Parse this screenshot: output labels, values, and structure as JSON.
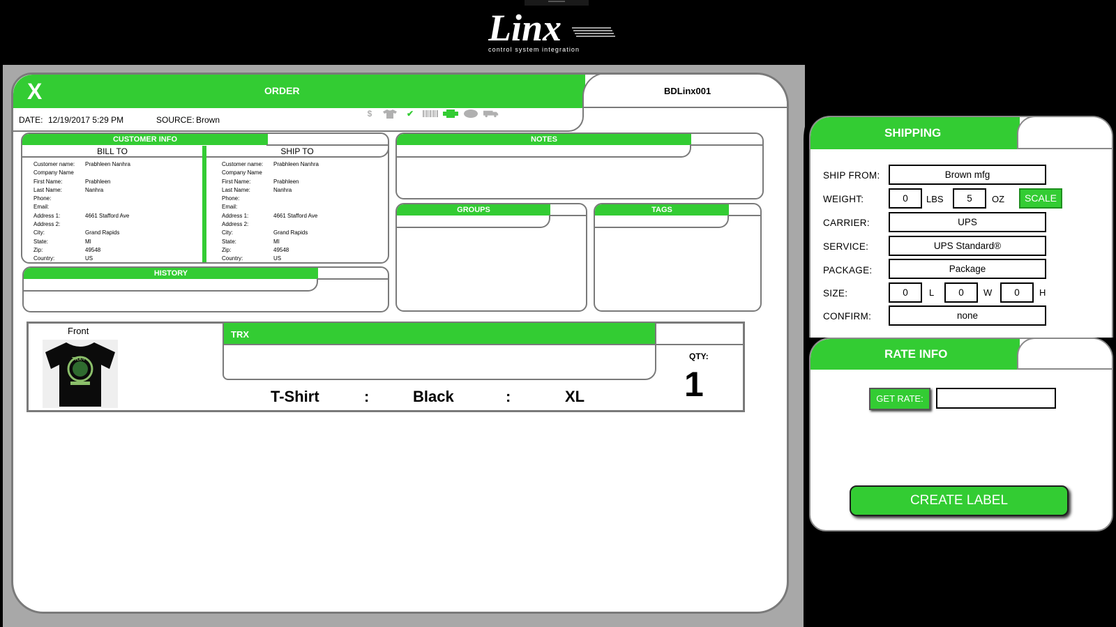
{
  "logo": {
    "text": "Linx",
    "tagline": "control system integration"
  },
  "order": {
    "close_label": "X",
    "title": "ORDER",
    "id": "BDLinx001",
    "date_label": "DATE:",
    "date_value": "12/19/2017 5:29 PM",
    "source_label": "SOURCE:",
    "source_value": "Brown",
    "status_icons": [
      {
        "icon": "dollar-icon",
        "glyph": "$",
        "color": "#b0b0b0"
      },
      {
        "icon": "tshirt-icon",
        "glyph": "",
        "color": "#b0b0b0"
      },
      {
        "icon": "check-icon",
        "glyph": "✔",
        "color": "#33cc33"
      },
      {
        "icon": "barcode-icon",
        "glyph": "",
        "color": "#b0b0b0"
      },
      {
        "icon": "printer-icon",
        "glyph": "",
        "color": "#33cc33"
      },
      {
        "icon": "package-icon",
        "glyph": "",
        "color": "#b0b0b0"
      },
      {
        "icon": "truck-icon",
        "glyph": "",
        "color": "#b0b0b0"
      }
    ]
  },
  "customer": {
    "title": "CUSTOMER INFO",
    "bill_to_title": "BILL TO",
    "ship_to_title": "SHIP TO",
    "bill_to": [
      {
        "k": "Customer name:",
        "v": "Prabhleen Nanhra"
      },
      {
        "k": "Company Name",
        "v": ""
      },
      {
        "k": "First Name:",
        "v": "Prabhleen"
      },
      {
        "k": "Last Name:",
        "v": "Nanhra"
      },
      {
        "k": "Phone:",
        "v": ""
      },
      {
        "k": "Email:",
        "v": ""
      },
      {
        "k": "Address 1:",
        "v": "4661 Stafford Ave"
      },
      {
        "k": "Address 2:",
        "v": ""
      },
      {
        "k": "City:",
        "v": "Grand Rapids"
      },
      {
        "k": "State:",
        "v": "MI"
      },
      {
        "k": "Zip:",
        "v": "49548"
      },
      {
        "k": "Country:",
        "v": "US"
      }
    ],
    "ship_to": [
      {
        "k": "Customer name:",
        "v": "Prabhleen Nanhra"
      },
      {
        "k": "Company Name",
        "v": ""
      },
      {
        "k": "First Name:",
        "v": "Prabhleen"
      },
      {
        "k": "Last Name:",
        "v": "Nanhra"
      },
      {
        "k": "Phone:",
        "v": ""
      },
      {
        "k": "Email:",
        "v": ""
      },
      {
        "k": "Address 1:",
        "v": "4661 Stafford Ave"
      },
      {
        "k": "Address 2:",
        "v": ""
      },
      {
        "k": "City:",
        "v": "Grand Rapids"
      },
      {
        "k": "State:",
        "v": "MI"
      },
      {
        "k": "Zip:",
        "v": "49548"
      },
      {
        "k": "Country:",
        "v": "US"
      }
    ]
  },
  "notes": {
    "title": "NOTES"
  },
  "groups": {
    "title": "GROUPS"
  },
  "tags": {
    "title": "TAGS"
  },
  "history": {
    "title": "HISTORY"
  },
  "product": {
    "front_label": "Front",
    "image_icon": "tshirt-icon",
    "trx_label": "TRX",
    "qty_label": "QTY:",
    "qty_value": "1",
    "item": "T-Shirt",
    "sep1": ":",
    "color": "Black",
    "sep2": ":",
    "size": "XL"
  },
  "shipping": {
    "title": "SHIPPING",
    "ship_from_label": "SHIP FROM:",
    "ship_from": "Brown mfg",
    "weight_label": "WEIGHT:",
    "weight_lbs": "0",
    "lbs_unit": "LBS",
    "weight_oz": "5",
    "oz_unit": "OZ",
    "scale_label": "SCALE",
    "carrier_label": "CARRIER:",
    "carrier": "UPS",
    "service_label": "SERVICE:",
    "service": "UPS Standard®",
    "package_label": "PACKAGE:",
    "package": "Package",
    "size_label": "SIZE:",
    "size_l": "0",
    "l_unit": "L",
    "size_w": "0",
    "w_unit": "W",
    "size_h": "0",
    "h_unit": "H",
    "confirm_label": "CONFIRM:",
    "confirm": "none"
  },
  "rate": {
    "title": "RATE INFO",
    "get_rate_label": "GET RATE:",
    "rate_value": "",
    "create_label": "CREATE LABEL"
  },
  "colors": {
    "accent": "#33cc33",
    "border": "#7a7a7a",
    "backdrop": "#a8a8a8"
  }
}
